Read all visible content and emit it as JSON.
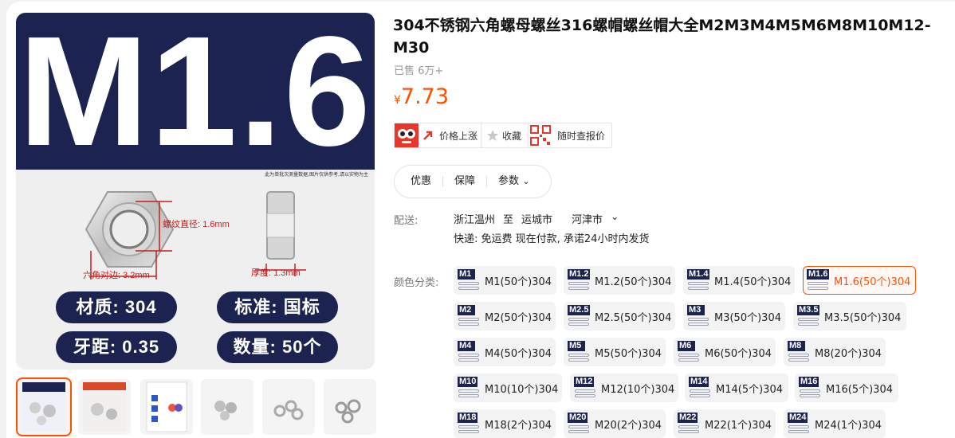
{
  "product": {
    "title": "304不锈钢六角螺母螺丝316螺帽螺丝帽大全M2M3M4M5M6M8M10M12-M30",
    "sold": "已售 6万+",
    "price_symbol": "¥",
    "price": "7.73"
  },
  "main_image": {
    "big_title": "M1.6",
    "disclaimer": "此为单批次测量数据,图片仅供参考,请以实物为主",
    "spec_thread": "螺纹直径: 1.6mm",
    "spec_across_flats": "六角对边: 3.2mm",
    "spec_thickness": "厚度: 1.3mm",
    "pills": [
      "材质: 304",
      "标准: 国标",
      "牙距: 0.35",
      "数量: 50个"
    ]
  },
  "thumbnails": [
    {
      "name": "thumb-1",
      "active": true
    },
    {
      "name": "thumb-2",
      "active": false
    },
    {
      "name": "thumb-3",
      "active": false
    },
    {
      "name": "thumb-4",
      "active": false
    },
    {
      "name": "thumb-5",
      "active": false
    },
    {
      "name": "thumb-6",
      "active": false
    }
  ],
  "actions": {
    "price_up": "价格上涨",
    "favorite": "收藏",
    "check_price": "随时查报价"
  },
  "tabs": [
    "优惠",
    "保障",
    "参数"
  ],
  "shipping": {
    "label": "配送:",
    "from": "浙江温州",
    "to_word": "至",
    "to_city": "运城市",
    "to_district": "河津市",
    "detail": "快递: 免运费  现在付款, 承诺24小时内发货"
  },
  "sku": {
    "label": "颜色分类:",
    "items": [
      {
        "icon": "M1",
        "label": "M1(50个)304"
      },
      {
        "icon": "M1.2",
        "label": "M1.2(50个)304"
      },
      {
        "icon": "M1.4",
        "label": "M1.4(50个)304"
      },
      {
        "icon": "M1.6",
        "label": "M1.6(50个)304",
        "selected": true
      },
      {
        "icon": "M2",
        "label": "M2(50个)304"
      },
      {
        "icon": "M2.5",
        "label": "M2.5(50个)304"
      },
      {
        "icon": "M3",
        "label": "M3(50个)304"
      },
      {
        "icon": "M3.5",
        "label": "M3.5(50个)304"
      },
      {
        "icon": "M4",
        "label": "M4(50个)304"
      },
      {
        "icon": "M5",
        "label": "M5(50个)304"
      },
      {
        "icon": "M6",
        "label": "M6(50个)304"
      },
      {
        "icon": "M8",
        "label": "M8(20个)304"
      },
      {
        "icon": "M10",
        "label": "M10(10个)304"
      },
      {
        "icon": "M12",
        "label": "M12(10个)304"
      },
      {
        "icon": "M14",
        "label": "M14(5个)304"
      },
      {
        "icon": "M16",
        "label": "M16(5个)304"
      },
      {
        "icon": "M18",
        "label": "M18(2个)304"
      },
      {
        "icon": "M20",
        "label": "M20(2个)304"
      },
      {
        "icon": "M22",
        "label": "M22(1个)304"
      },
      {
        "icon": "M24",
        "label": "M24(1个)304"
      }
    ]
  },
  "colors": {
    "accent": "#ff5000",
    "navy": "#1c2350",
    "dimension_red": "#c31e1e"
  }
}
